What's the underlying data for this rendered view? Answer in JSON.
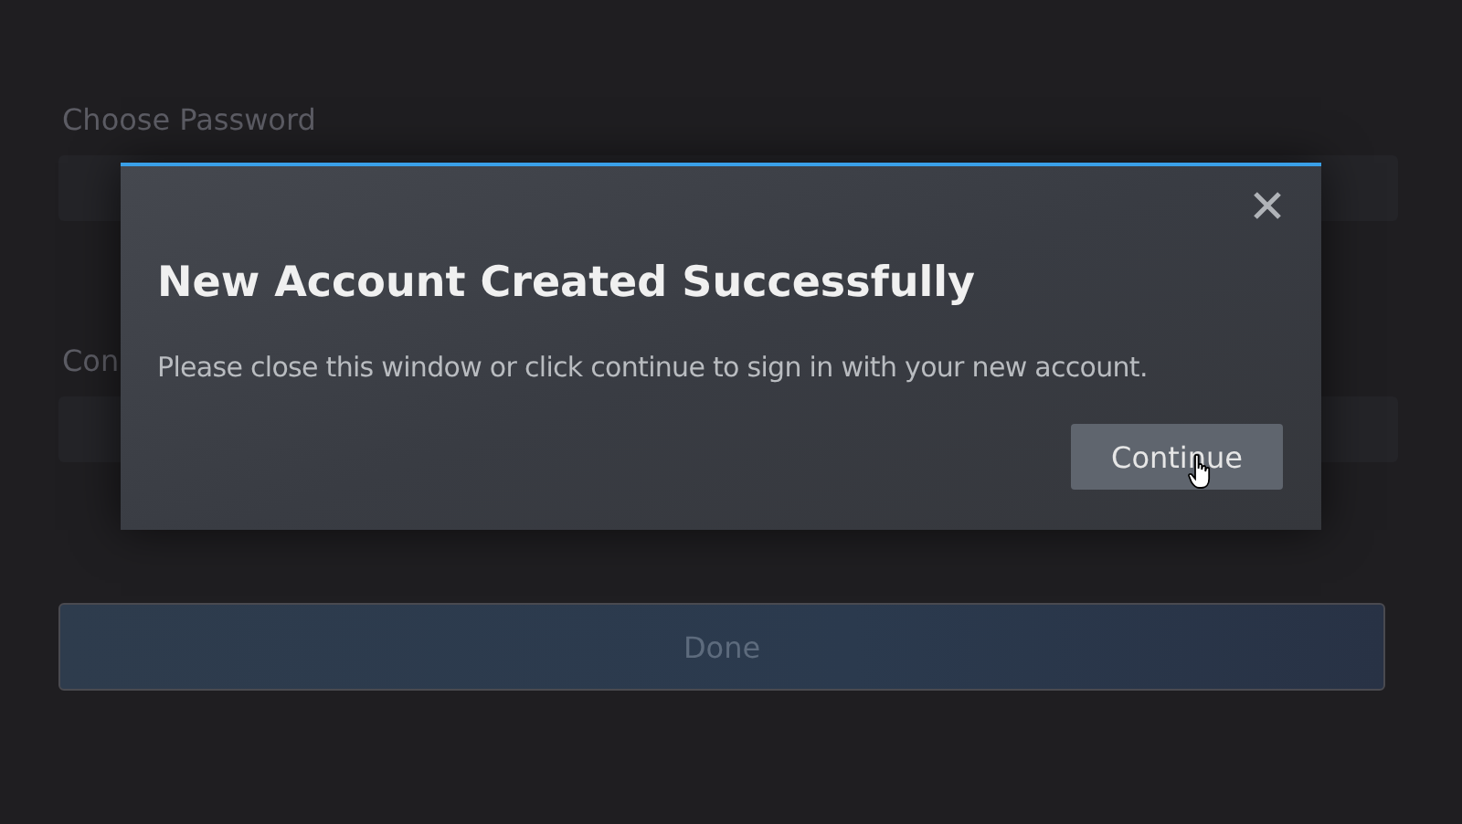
{
  "form": {
    "fields": [
      {
        "label": "Choose Password"
      },
      {
        "label": "Con"
      }
    ],
    "submit": {
      "label": "Done"
    }
  },
  "dialog": {
    "title": "New Account Created Successfully",
    "message": "Please close this window or click continue to sign in with your new account.",
    "button": {
      "label": "Continue"
    }
  }
}
